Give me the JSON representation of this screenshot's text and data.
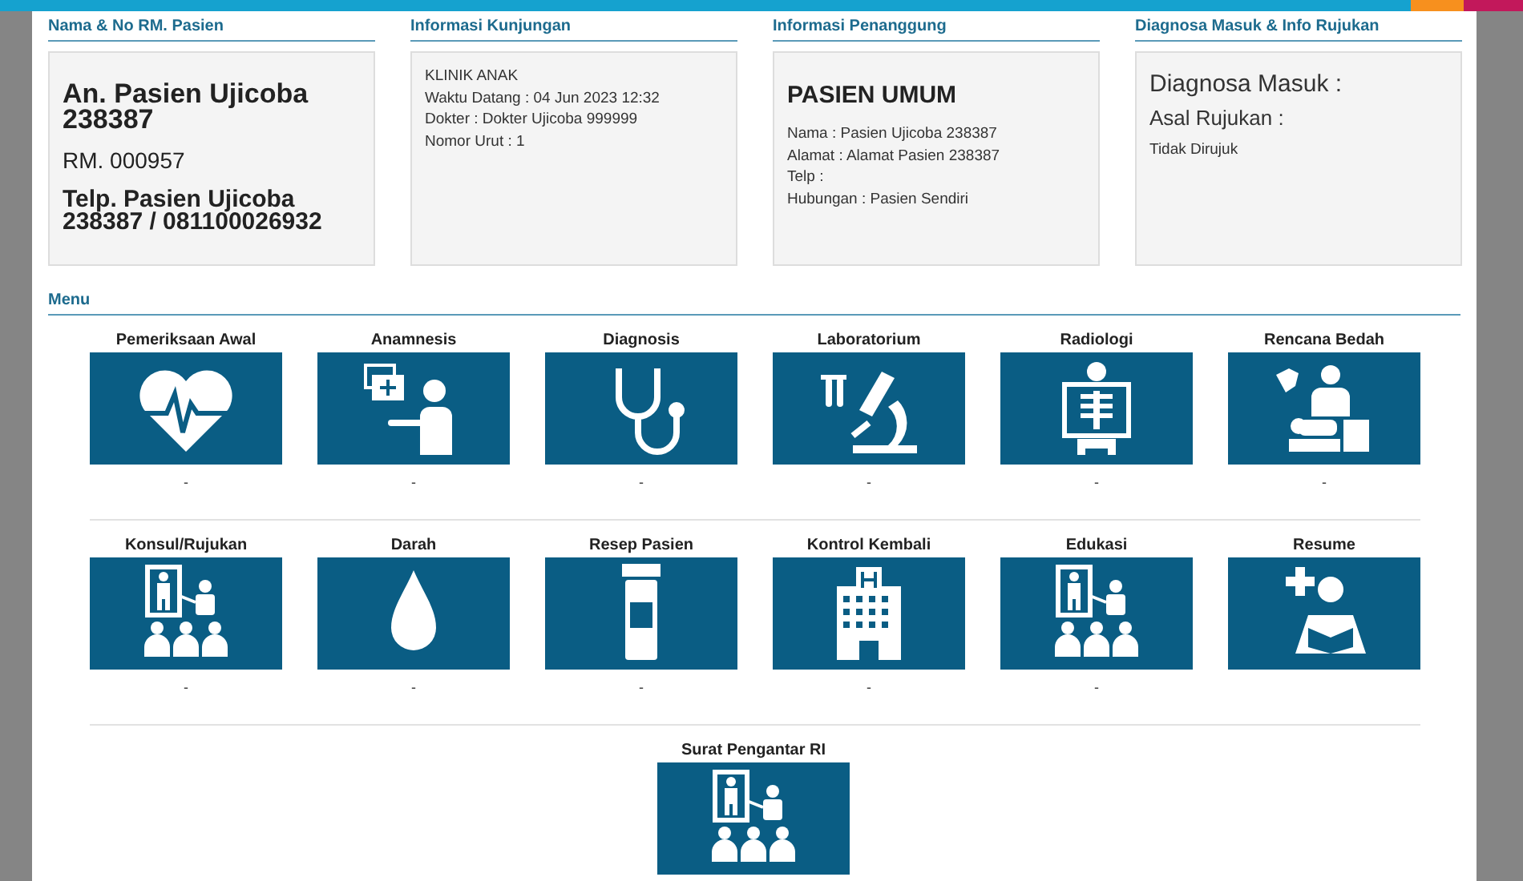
{
  "panels": [
    {
      "title": "Nama & No RM. Pasien",
      "lines": [
        {
          "kind": "large",
          "text": "An. Pasien Ujicoba 238387"
        },
        {
          "kind": "medium",
          "text": "RM. 000957"
        },
        {
          "kind": "large-sm",
          "text": "Telp. Pasien Ujicoba 238387 / 081100026932"
        }
      ]
    },
    {
      "title": "Informasi Kunjungan",
      "lines": [
        {
          "kind": "small",
          "text": "KLINIK ANAK"
        },
        {
          "kind": "small",
          "text": "Waktu Datang : 04 Jun 2023 12:32"
        },
        {
          "kind": "small",
          "text": "Dokter : Dokter Ujicoba 999999"
        },
        {
          "kind": "small",
          "text": "Nomor Urut : 1"
        }
      ]
    },
    {
      "title": "Informasi Penanggung",
      "lines": [
        {
          "kind": "heading",
          "text": "PASIEN UMUM"
        },
        {
          "kind": "small",
          "text": "Nama : Pasien Ujicoba 238387"
        },
        {
          "kind": "small",
          "text": "Alamat : Alamat Pasien 238387"
        },
        {
          "kind": "small",
          "text": "Telp :"
        },
        {
          "kind": "small",
          "text": "Hubungan : Pasien Sendiri"
        }
      ]
    },
    {
      "title": "Diagnosa Masuk & Info Rujukan",
      "lines": [
        {
          "kind": "light-lg",
          "text": "Diagnosa Masuk :"
        },
        {
          "kind": "light-md",
          "text": "Asal Rujukan :"
        },
        {
          "kind": "small",
          "text": "Tidak Dirujuk"
        }
      ]
    }
  ],
  "menu": {
    "title": "Menu",
    "rows": [
      [
        {
          "label": "Pemeriksaan Awal",
          "note": "-"
        },
        {
          "label": "Anamnesis",
          "note": "-"
        },
        {
          "label": "Diagnosis",
          "note": "-"
        },
        {
          "label": "Laboratorium",
          "note": "-"
        },
        {
          "label": "Radiologi",
          "note": "-"
        },
        {
          "label": "Rencana Bedah",
          "note": "-"
        }
      ],
      [
        {
          "label": "Konsul/Rujukan",
          "note": "-"
        },
        {
          "label": "Darah",
          "note": "-"
        },
        {
          "label": "Resep Pasien",
          "note": "-"
        },
        {
          "label": "Kontrol Kembali",
          "note": "-"
        },
        {
          "label": "Edukasi",
          "note": "-"
        },
        {
          "label": "Resume"
        }
      ],
      [
        {
          "label": "Surat Pengantar RI"
        }
      ]
    ]
  }
}
